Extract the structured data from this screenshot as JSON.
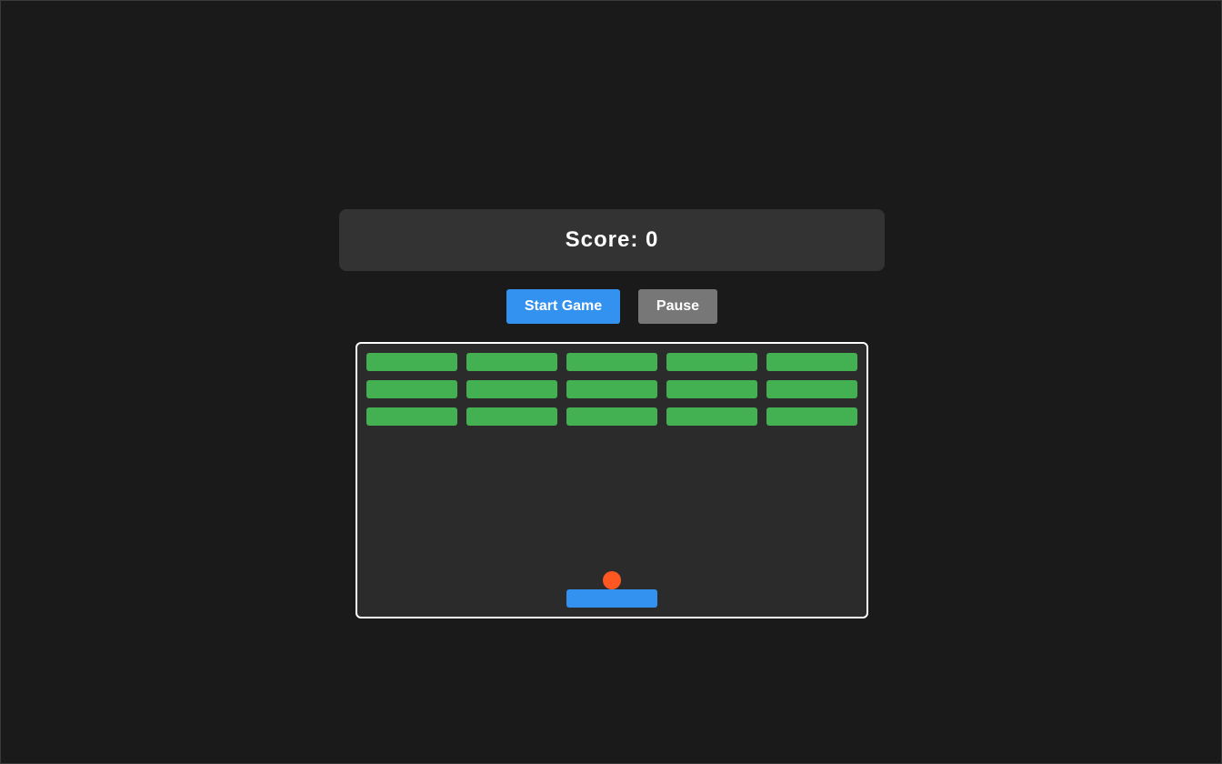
{
  "score": {
    "label": "Score: 0",
    "value": 0
  },
  "controls": {
    "start_label": "Start Game",
    "pause_label": "Pause"
  },
  "board": {
    "brick_rows": 3,
    "brick_cols": 5,
    "bricks_remaining": 15
  },
  "colors": {
    "background": "#1a1a1a",
    "panel": "#333333",
    "board": "#2b2b2b",
    "board_border": "#ffffff",
    "brick": "#43b052",
    "paddle": "#3391f0",
    "ball": "#ff5722",
    "start_button": "#3391f0",
    "pause_button": "#777777"
  }
}
